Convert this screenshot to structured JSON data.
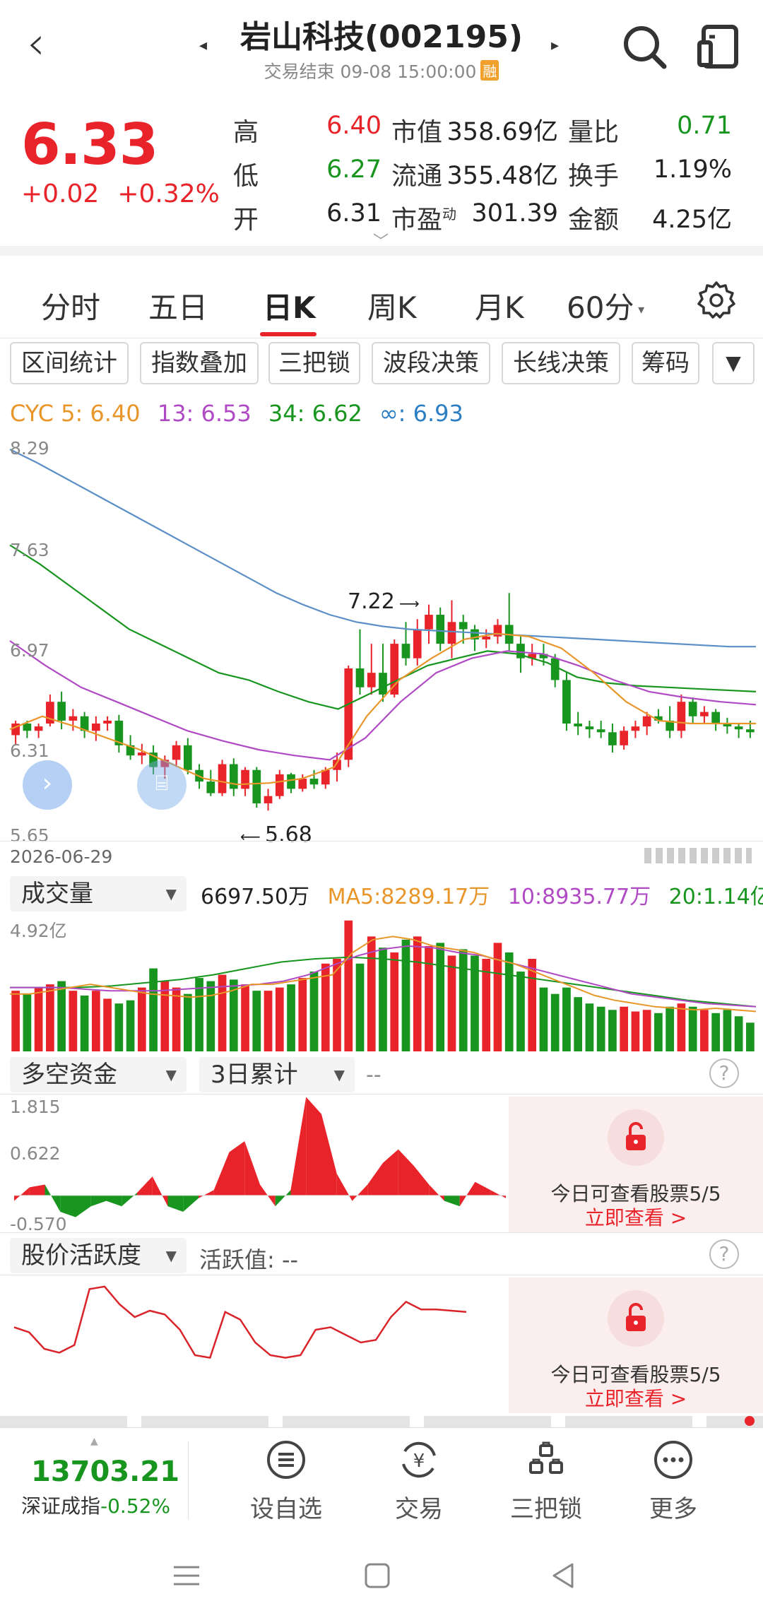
{
  "header": {
    "title": "岩山科技(002195)",
    "status": "交易结束 09-08 15:00:00",
    "badge": "融"
  },
  "quote": {
    "price": "6.33",
    "change": "+0.02",
    "change_pct": "+0.32%",
    "rows": [
      {
        "l1": "高",
        "v1": "6.40",
        "l2": "市值",
        "v2": "358.69亿",
        "l3": "量比",
        "v3": "0.71"
      },
      {
        "l1": "低",
        "v1": "6.27",
        "l2": "流通",
        "v2": "355.48亿",
        "l3": "换手",
        "v3": "1.19%"
      },
      {
        "l1": "开",
        "v1": "6.31",
        "l2": "市盈",
        "l2_sup": "动",
        "v2": "301.39",
        "l3": "金额",
        "v3": "4.25亿"
      }
    ]
  },
  "colors": {
    "up": "#e8232a",
    "down": "#18951f",
    "accent": "#e8232a"
  },
  "period_tabs": [
    "分时",
    "五日",
    "日K",
    "周K",
    "月K",
    "60分"
  ],
  "active_tab": "日K",
  "tools": [
    "区间统计",
    "指数叠加",
    "三把锁",
    "波段决策",
    "长线决策",
    "筹码"
  ],
  "cyc": {
    "prefix": "CYC 5: 6.40",
    "c13": "13: 6.53",
    "c34": "34: 6.62",
    "cinf": "∞: 6.93"
  },
  "axis": {
    "y_labels": [
      "8.29",
      "7.63",
      "6.97",
      "6.31",
      "5.65"
    ],
    "high_mark": "7.22",
    "low_mark": "5.68",
    "start_date": "2026-06-29"
  },
  "volume": {
    "selector": "成交量",
    "value": "6697.50万",
    "ma5": "MA5:8289.17万",
    "ma10": "10:8935.77万",
    "ma20": "20:1.14亿",
    "top_label": "4.92亿"
  },
  "bullbear": {
    "selector": "多空资金",
    "period": "3日累计",
    "value": "--",
    "y_labels": [
      "1.815",
      "0.622",
      "-0.570"
    ]
  },
  "activity": {
    "selector": "股价活跃度",
    "label": "活跃值: --"
  },
  "lock": {
    "text": "今日可查看股票5/5",
    "link": "立即查看 >"
  },
  "bottom": {
    "index_value": "13703.21",
    "index_name": "深证成指",
    "index_change": "-0.52%",
    "nav": [
      "设自选",
      "交易",
      "三把锁",
      "更多"
    ]
  },
  "chart_data": {
    "type": "candlestick",
    "y_range": [
      5.65,
      8.29
    ],
    "candles": [
      [
        6.32,
        6.42,
        6.25,
        6.4
      ],
      [
        6.4,
        6.42,
        6.3,
        6.35
      ],
      [
        6.35,
        6.4,
        6.3,
        6.38
      ],
      [
        6.4,
        6.6,
        6.38,
        6.55
      ],
      [
        6.55,
        6.62,
        6.36,
        6.42
      ],
      [
        6.42,
        6.5,
        6.35,
        6.45
      ],
      [
        6.45,
        6.48,
        6.3,
        6.35
      ],
      [
        6.35,
        6.45,
        6.28,
        6.4
      ],
      [
        6.4,
        6.45,
        6.35,
        6.42
      ],
      [
        6.42,
        6.46,
        6.2,
        6.25
      ],
      [
        6.25,
        6.32,
        6.15,
        6.18
      ],
      [
        6.18,
        6.26,
        6.12,
        6.2
      ],
      [
        6.2,
        6.25,
        6.05,
        6.1
      ],
      [
        6.1,
        6.18,
        6.02,
        6.15
      ],
      [
        6.15,
        6.28,
        6.1,
        6.25
      ],
      [
        6.25,
        6.3,
        6.05,
        6.08
      ],
      [
        6.08,
        6.12,
        5.95,
        6.0
      ],
      [
        6.0,
        6.08,
        5.9,
        5.92
      ],
      [
        5.92,
        6.15,
        5.9,
        6.12
      ],
      [
        6.12,
        6.16,
        5.9,
        5.95
      ],
      [
        5.95,
        6.1,
        5.9,
        6.08
      ],
      [
        6.08,
        6.1,
        5.82,
        5.85
      ],
      [
        5.85,
        5.95,
        5.8,
        5.9
      ],
      [
        5.9,
        6.08,
        5.88,
        6.05
      ],
      [
        6.05,
        6.06,
        5.92,
        5.95
      ],
      [
        5.95,
        6.05,
        5.93,
        6.02
      ],
      [
        6.02,
        6.08,
        5.95,
        5.98
      ],
      [
        5.98,
        6.1,
        5.95,
        6.08
      ],
      [
        6.08,
        6.2,
        6.0,
        6.15
      ],
      [
        6.15,
        6.8,
        6.1,
        6.78
      ],
      [
        6.78,
        7.05,
        6.6,
        6.65
      ],
      [
        6.65,
        6.95,
        6.6,
        6.75
      ],
      [
        6.75,
        6.95,
        6.55,
        6.6
      ],
      [
        6.6,
        6.98,
        6.58,
        6.95
      ],
      [
        6.95,
        7.1,
        6.8,
        6.85
      ],
      [
        6.85,
        7.12,
        6.8,
        7.05
      ],
      [
        7.05,
        7.22,
        6.95,
        7.15
      ],
      [
        7.15,
        7.2,
        6.9,
        6.95
      ],
      [
        6.95,
        7.25,
        6.85,
        7.1
      ],
      [
        7.1,
        7.15,
        6.95,
        7.05
      ],
      [
        7.05,
        7.08,
        6.9,
        6.98
      ],
      [
        6.98,
        7.05,
        6.92,
        7.0
      ],
      [
        7.0,
        7.12,
        6.95,
        7.08
      ],
      [
        7.08,
        7.3,
        6.9,
        6.95
      ],
      [
        6.95,
        7.0,
        6.75,
        6.85
      ],
      [
        6.85,
        6.95,
        6.8,
        6.88
      ],
      [
        6.88,
        6.95,
        6.8,
        6.85
      ],
      [
        6.85,
        6.88,
        6.65,
        6.7
      ],
      [
        6.7,
        6.75,
        6.35,
        6.4
      ],
      [
        6.4,
        6.48,
        6.32,
        6.38
      ],
      [
        6.38,
        6.42,
        6.3,
        6.36
      ],
      [
        6.36,
        6.42,
        6.3,
        6.34
      ],
      [
        6.34,
        6.4,
        6.2,
        6.25
      ],
      [
        6.25,
        6.38,
        6.22,
        6.35
      ],
      [
        6.35,
        6.42,
        6.3,
        6.38
      ],
      [
        6.38,
        6.48,
        6.32,
        6.45
      ],
      [
        6.45,
        6.5,
        6.4,
        6.42
      ],
      [
        6.42,
        6.52,
        6.3,
        6.35
      ],
      [
        6.35,
        6.6,
        6.3,
        6.55
      ],
      [
        6.55,
        6.58,
        6.4,
        6.45
      ],
      [
        6.45,
        6.52,
        6.4,
        6.48
      ],
      [
        6.48,
        6.5,
        6.35,
        6.4
      ],
      [
        6.4,
        6.44,
        6.33,
        6.38
      ],
      [
        6.38,
        6.4,
        6.3,
        6.36
      ],
      [
        6.36,
        6.42,
        6.3,
        6.34
      ]
    ],
    "ma_cinf": [
      8.29,
      8.2,
      8.1,
      8.0,
      7.9,
      7.8,
      7.7,
      7.6,
      7.5,
      7.4,
      7.3,
      7.22,
      7.15,
      7.1,
      7.07,
      7.05,
      7.04,
      7.03,
      7.02,
      7.01,
      7.0,
      6.99,
      6.98,
      6.97,
      6.96,
      6.95,
      6.94,
      6.93,
      6.93
    ],
    "ma_c34": [
      7.63,
      7.5,
      7.35,
      7.2,
      7.05,
      6.95,
      6.85,
      6.75,
      6.7,
      6.62,
      6.55,
      6.5,
      6.6,
      6.7,
      6.8,
      6.85,
      6.9,
      6.88,
      6.82,
      6.72,
      6.68,
      6.66,
      6.65,
      6.64,
      6.63,
      6.62
    ],
    "ma_c13": [
      6.97,
      6.8,
      6.65,
      6.55,
      6.45,
      6.35,
      6.28,
      6.22,
      6.18,
      6.15,
      6.3,
      6.55,
      6.75,
      6.85,
      6.9,
      6.88,
      6.8,
      6.7,
      6.62,
      6.58,
      6.55,
      6.53
    ],
    "ma_c5": [
      6.36,
      6.45,
      6.38,
      6.3,
      6.22,
      6.12,
      6.02,
      5.98,
      5.99,
      6.02,
      6.1,
      6.45,
      6.7,
      6.85,
      6.98,
      7.02,
      7.0,
      6.92,
      6.75,
      6.55,
      6.42,
      6.4,
      6.4,
      6.4
    ],
    "volumes": [
      0.38,
      0.36,
      0.4,
      0.42,
      0.44,
      0.38,
      0.35,
      0.38,
      0.33,
      0.3,
      0.32,
      0.4,
      0.52,
      0.44,
      0.4,
      0.36,
      0.46,
      0.44,
      0.48,
      0.45,
      0.42,
      0.38,
      0.38,
      0.4,
      0.42,
      0.46,
      0.5,
      0.55,
      0.58,
      0.82,
      0.55,
      0.72,
      0.65,
      0.62,
      0.7,
      0.72,
      0.66,
      0.68,
      0.6,
      0.64,
      0.6,
      0.58,
      0.68,
      0.62,
      0.5,
      0.58,
      0.4,
      0.36,
      0.4,
      0.34,
      0.3,
      0.28,
      0.26,
      0.28,
      0.25,
      0.26,
      0.24,
      0.28,
      0.3,
      0.28,
      0.26,
      0.24,
      0.26,
      0.22,
      0.18
    ],
    "vol_ma5": [
      0.36,
      0.36,
      0.38,
      0.4,
      0.42,
      0.4,
      0.38,
      0.36,
      0.35,
      0.34,
      0.35,
      0.38,
      0.42,
      0.42,
      0.44,
      0.46,
      0.48,
      0.62,
      0.7,
      0.72,
      0.7,
      0.66,
      0.64,
      0.62,
      0.58,
      0.55,
      0.5,
      0.45,
      0.4,
      0.35,
      0.32,
      0.3,
      0.28,
      0.27,
      0.26,
      0.27,
      0.26,
      0.25
    ],
    "vol_ma10": [
      0.4,
      0.4,
      0.4,
      0.39,
      0.38,
      0.38,
      0.38,
      0.39,
      0.4,
      0.41,
      0.42,
      0.44,
      0.48,
      0.54,
      0.6,
      0.64,
      0.66,
      0.65,
      0.62,
      0.6,
      0.56,
      0.52,
      0.48,
      0.44,
      0.4,
      0.36,
      0.34,
      0.32,
      0.3,
      0.29,
      0.28
    ],
    "vol_ma20": [
      0.4,
      0.4,
      0.4,
      0.41,
      0.43,
      0.45,
      0.48,
      0.52,
      0.56,
      0.58,
      0.59,
      0.58,
      0.56,
      0.53,
      0.5,
      0.47,
      0.44,
      0.41,
      0.38,
      0.35,
      0.32,
      0.3,
      0.28
    ],
    "bullbear": [
      -0.1,
      0.15,
      0.2,
      -0.3,
      -0.4,
      -0.2,
      -0.1,
      -0.2,
      0.05,
      0.35,
      -0.2,
      -0.3,
      -0.05,
      0.1,
      0.8,
      1.0,
      0.2,
      -0.2,
      0.1,
      1.815,
      1.5,
      0.4,
      -0.1,
      0.2,
      0.6,
      0.85,
      0.55,
      0.2,
      -0.1,
      -0.2,
      0.25,
      0.1,
      -0.05
    ],
    "activity": [
      0.62,
      0.58,
      0.45,
      0.42,
      0.48,
      0.92,
      0.94,
      0.8,
      0.7,
      0.75,
      0.72,
      0.6,
      0.4,
      0.38,
      0.74,
      0.68,
      0.5,
      0.4,
      0.38,
      0.4,
      0.6,
      0.62,
      0.56,
      0.5,
      0.52,
      0.7,
      0.82,
      0.76,
      0.76,
      0.75,
      0.74
    ]
  }
}
